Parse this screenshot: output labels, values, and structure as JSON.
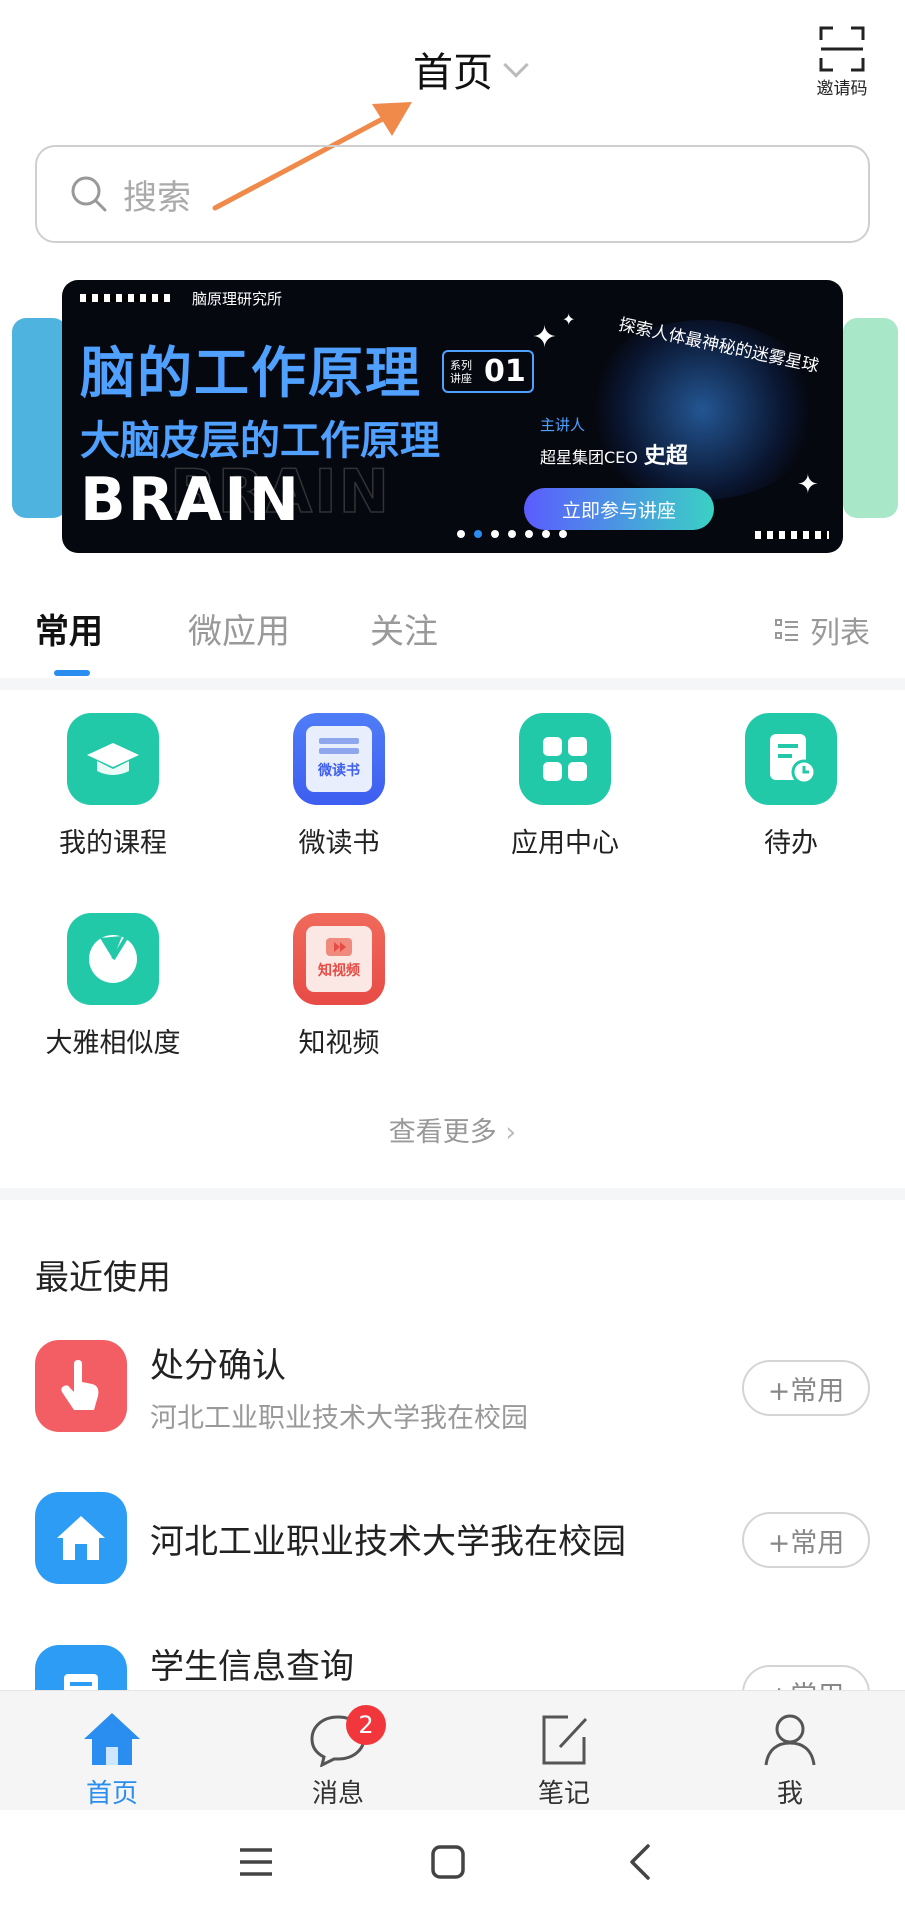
{
  "header": {
    "title": "首页",
    "invite_label": "邀请码"
  },
  "search": {
    "placeholder": "搜索"
  },
  "banner": {
    "org": "脑原理研究所",
    "headline": "脑的工作原理",
    "series_label": "系列讲座",
    "series_number": "01",
    "subheadline": "大脑皮层的工作原理",
    "brand_word": "BRAIN",
    "tagline": "探索人体最神秘的迷雾星球",
    "speaker_label": "主讲人",
    "speaker_org": "超星集团CEO",
    "speaker_name": "史超",
    "cta": "立即参与讲座",
    "page_count": 7,
    "active_page": 2
  },
  "tabs": {
    "items": [
      "常用",
      "微应用",
      "关注"
    ],
    "active": "常用",
    "list_toggle": "列表"
  },
  "apps": [
    {
      "name": "我的课程",
      "icon": "graduation-cap-icon",
      "color": "#22c9a8"
    },
    {
      "name": "微读书",
      "icon": "book-icon",
      "color": "#3d6ef5",
      "icon_text": "微读书"
    },
    {
      "name": "应用中心",
      "icon": "app-grid-icon",
      "color": "#22c9a8"
    },
    {
      "name": "待办",
      "icon": "todo-clock-icon",
      "color": "#22c9a8"
    },
    {
      "name": "大雅相似度",
      "icon": "pie-chart-icon",
      "color": "#22c9a8"
    },
    {
      "name": "知视频",
      "icon": "video-icon",
      "color": "#ec5b4f",
      "icon_text": "知视频"
    }
  ],
  "more_link": "查看更多",
  "recent": {
    "title": "最近使用",
    "items": [
      {
        "title": "处分确认",
        "subtitle": "河北工业职业技术大学我在校园",
        "button": "+常用",
        "icon": "hand-tap-icon",
        "color": "#f25e63"
      },
      {
        "title": "河北工业职业技术大学我在校园",
        "subtitle": "",
        "button": "+常用",
        "icon": "house-icon",
        "color": "#2c9cf5"
      },
      {
        "title": "学生信息查询",
        "subtitle": "",
        "button": "+常用",
        "icon": "document-icon",
        "color": "#2c9cf5"
      }
    ]
  },
  "nav": {
    "items": [
      {
        "label": "首页",
        "icon": "home-icon"
      },
      {
        "label": "消息",
        "icon": "message-icon",
        "badge": "2"
      },
      {
        "label": "笔记",
        "icon": "note-edit-icon"
      },
      {
        "label": "我",
        "icon": "profile-icon"
      }
    ],
    "active": "首页"
  },
  "colors": {
    "accent": "#2a8ef0",
    "teal": "#22c9a8",
    "badge": "#f2373c",
    "arrow": "#f08a4b"
  }
}
